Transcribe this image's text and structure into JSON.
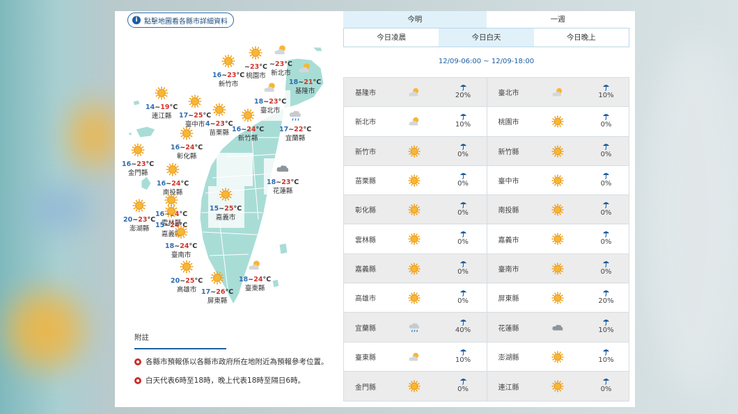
{
  "map": {
    "hint": "點擊地圖看各縣市詳細資料",
    "cities": [
      {
        "name": "新竹市",
        "lo": "16",
        "hi": "23",
        "icon": "sunny-icon"
      },
      {
        "name": "桃園市",
        "lo": "",
        "hi": "23",
        "icon": "sunny-icon"
      },
      {
        "name": "新北市",
        "lo": "",
        "hi": "23",
        "icon": "partly-cloudy-icon"
      },
      {
        "name": "基隆市",
        "lo": "18",
        "hi": "21",
        "icon": "partly-cloudy-icon"
      },
      {
        "name": "臺北市",
        "lo": "18",
        "hi": "23",
        "icon": "partly-cloudy-icon"
      },
      {
        "name": "連江縣",
        "lo": "14",
        "hi": "19",
        "icon": "sunny-icon"
      },
      {
        "name": "臺中市",
        "lo": "17",
        "hi": "25",
        "icon": "sunny-icon"
      },
      {
        "name": "苗栗縣",
        "lo": "4",
        "hi": "23",
        "icon": "sunny-icon"
      },
      {
        "name": "新竹縣",
        "lo": "16",
        "hi": "24",
        "icon": "sunny-icon"
      },
      {
        "name": "宜蘭縣",
        "lo": "17",
        "hi": "22",
        "icon": "rain-cloud-icon"
      },
      {
        "name": "彰化縣",
        "lo": "16",
        "hi": "24",
        "icon": "sunny-icon"
      },
      {
        "name": "金門縣",
        "lo": "16",
        "hi": "23",
        "icon": "sunny-icon"
      },
      {
        "name": "南投縣",
        "lo": "16",
        "hi": "24",
        "icon": "sunny-icon"
      },
      {
        "name": "花蓮縣",
        "lo": "18",
        "hi": "23",
        "icon": "cloudy-icon"
      },
      {
        "name": "雲林縣",
        "lo": "16",
        "hi": "24",
        "icon": "sunny-icon"
      },
      {
        "name": "嘉義市",
        "lo": "15",
        "hi": "25",
        "icon": "sunny-icon"
      },
      {
        "name": "澎湖縣",
        "lo": "20",
        "hi": "23",
        "icon": "sunny-icon"
      },
      {
        "name": "嘉義縣",
        "lo": "15",
        "hi": "24",
        "icon": "sunny-icon"
      },
      {
        "name": "臺南市",
        "lo": "18",
        "hi": "24",
        "icon": "sunny-icon"
      },
      {
        "name": "高雄市",
        "lo": "20",
        "hi": "25",
        "icon": "sunny-icon"
      },
      {
        "name": "屏東縣",
        "lo": "17",
        "hi": "26",
        "icon": "sunny-icon"
      },
      {
        "name": "臺東縣",
        "lo": "18",
        "hi": "24",
        "icon": "partly-cloudy-icon"
      }
    ],
    "unit": "°C"
  },
  "notes": {
    "title": "附註",
    "items": [
      "各縣市預報係以各縣市政府所在地附近為預報參考位置。",
      "白天代表6時至18時，晚上代表18時至隔日6時。"
    ]
  },
  "tabs": {
    "main": [
      "今明",
      "一週"
    ],
    "sub": [
      "今日凌晨",
      "今日白天",
      "今日晚上"
    ]
  },
  "period": "12/09-06:00 ~ 12/09-18:00",
  "table": [
    [
      {
        "name": "基隆市",
        "icon": "partly-cloudy-icon",
        "rain": "20%"
      },
      {
        "name": "臺北市",
        "icon": "partly-cloudy-icon",
        "rain": "10%"
      }
    ],
    [
      {
        "name": "新北市",
        "icon": "partly-cloudy-icon",
        "rain": "10%"
      },
      {
        "name": "桃園市",
        "icon": "sunny-icon",
        "rain": "0%"
      }
    ],
    [
      {
        "name": "新竹市",
        "icon": "sunny-icon",
        "rain": "0%"
      },
      {
        "name": "新竹縣",
        "icon": "sunny-icon",
        "rain": "0%"
      }
    ],
    [
      {
        "name": "苗栗縣",
        "icon": "sunny-icon",
        "rain": "0%"
      },
      {
        "name": "臺中市",
        "icon": "sunny-icon",
        "rain": "0%"
      }
    ],
    [
      {
        "name": "彰化縣",
        "icon": "sunny-icon",
        "rain": "0%"
      },
      {
        "name": "南投縣",
        "icon": "sunny-icon",
        "rain": "0%"
      }
    ],
    [
      {
        "name": "雲林縣",
        "icon": "sunny-icon",
        "rain": "0%"
      },
      {
        "name": "嘉義市",
        "icon": "sunny-icon",
        "rain": "0%"
      }
    ],
    [
      {
        "name": "嘉義縣",
        "icon": "sunny-icon",
        "rain": "0%"
      },
      {
        "name": "臺南市",
        "icon": "sunny-icon",
        "rain": "0%"
      }
    ],
    [
      {
        "name": "高雄市",
        "icon": "sunny-icon",
        "rain": "0%"
      },
      {
        "name": "屏東縣",
        "icon": "sunny-icon",
        "rain": "20%"
      }
    ],
    [
      {
        "name": "宜蘭縣",
        "icon": "rain-cloud-icon",
        "rain": "40%"
      },
      {
        "name": "花蓮縣",
        "icon": "cloudy-icon",
        "rain": "10%"
      }
    ],
    [
      {
        "name": "臺東縣",
        "icon": "partly-cloudy-icon",
        "rain": "10%"
      },
      {
        "name": "澎湖縣",
        "icon": "sunny-icon",
        "rain": "10%"
      }
    ],
    [
      {
        "name": "金門縣",
        "icon": "sunny-icon",
        "rain": "0%"
      },
      {
        "name": "連江縣",
        "icon": "sunny-icon",
        "rain": "0%"
      }
    ]
  ],
  "colors": {
    "accent": "#1d5ea0",
    "low_temp": "#2f6db0",
    "high_temp": "#d0352b",
    "map_fill": "#a8ddd6",
    "map_stroke": "#ffffff",
    "tab_active": "#e0f1fa"
  }
}
